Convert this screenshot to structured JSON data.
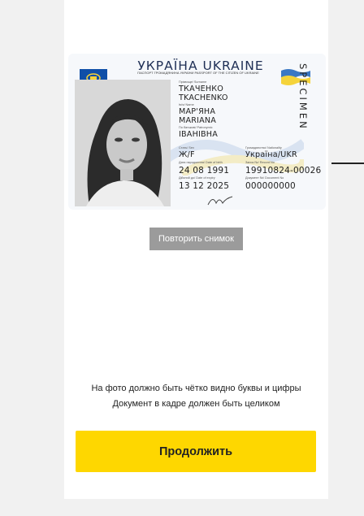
{
  "id_card": {
    "title": "УКРАЇНА UKRAINE",
    "title_sub": "ПАСПОРТ ГРОМАДЯНИНА УКРАЇНИ PASSPORT OF THE CITIZEN OF UKRAINE",
    "specimen": "SPECIMEN",
    "surname_label": "Прізвище/ Surname",
    "surname_ua": "ТКАЧЕНКО",
    "surname_en": "TKACHENKO",
    "name_label": "Ім'я/ Name",
    "name_ua": "МАР'ЯНА",
    "name_en": "MARIANA",
    "patronymic_label": "По батькові/ Patronymic",
    "patronymic": "ІВАНІВНА",
    "sex_label": "Стать/ Sex",
    "sex": "Ж/F",
    "nationality_label": "Громадянство/ Nationality",
    "nationality": "Україна/UKR",
    "dob_label": "Дата народження/ Date of birth",
    "dob": "24 08 1991",
    "record_label": "Запис №/ Record No",
    "record": "19910824-00026",
    "expiry_label": "Дійсний до/ Date of expiry",
    "expiry": "13 12 2025",
    "doc_label": "Документ №/ Document No",
    "doc": "000000000"
  },
  "retake_label": "Повторить снимок",
  "hint_line1": "На фото должно быть чётко видно буквы и цифры",
  "hint_line2": "Документ в кадре должен быть целиком",
  "continue_label": "Продолжить",
  "colors": {
    "accent": "#fed700",
    "retake_bg": "#9b9b9b",
    "panel": "#ffffff",
    "page_bg": "#f1f1f1"
  }
}
